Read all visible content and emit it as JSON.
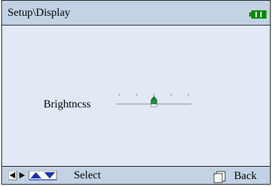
{
  "header": {
    "title": "Setup\\Display",
    "battery_icon": "battery-full-icon",
    "battery_color": "#0a8a0a"
  },
  "settings": {
    "brightness": {
      "label": "Brightncss",
      "level": 0.5,
      "ticks": 5
    }
  },
  "footer": {
    "nav_icons": [
      "left-arrow-icon",
      "right-arrow-icon",
      "up-arrow-icon",
      "down-arrow-icon"
    ],
    "select_label": "Select",
    "back_icon": "back-page-icon",
    "back_label": "Back"
  },
  "colors": {
    "header_bg": "#c3d2e3",
    "content_bg": "#e0e9f4",
    "thumb": "#1f8f3a",
    "nav_up_down": "#1a2fb0"
  }
}
